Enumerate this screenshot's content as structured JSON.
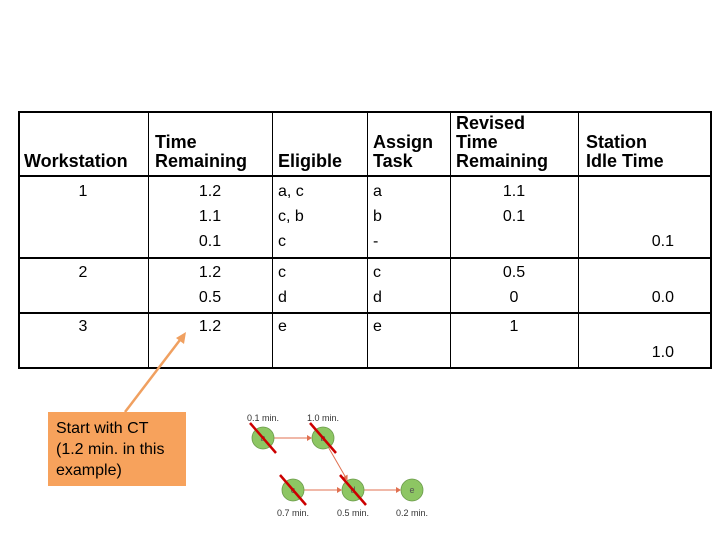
{
  "headers": {
    "workstation": "Workstation",
    "time_remaining": [
      "Time",
      "Remaining"
    ],
    "eligible": "Eligible",
    "assign_task": [
      "Assign",
      "Task"
    ],
    "revised": [
      "Revised",
      "Time",
      "Remaining"
    ],
    "idle": [
      "Station",
      "Idle Time"
    ]
  },
  "rows": [
    {
      "ws": "1",
      "lines": [
        [
          "1.2",
          "a, c",
          "a",
          "1.1"
        ],
        [
          "1.1",
          "c, b",
          "b",
          "0.1"
        ],
        [
          "0.1",
          "c",
          "-",
          ""
        ]
      ],
      "idle": "0.1"
    },
    {
      "ws": "2",
      "lines": [
        [
          "1.2",
          "c",
          "c",
          "0.5"
        ],
        [
          "0.5",
          "d",
          "d",
          "0"
        ]
      ],
      "idle": "0.0"
    },
    {
      "ws": "3",
      "lines": [
        [
          "1.2",
          "e",
          "e",
          "1"
        ]
      ],
      "idle": "1.0"
    }
  ],
  "note": "Start with CT (1.2 min. in this example)",
  "colors": {
    "note_bg": "#f7a25c",
    "arrow": "#f0a060",
    "node": "#8dc663",
    "cross": "#cc0000",
    "edge": "#e07050"
  },
  "network": {
    "nodes": [
      {
        "id": "a",
        "time": "0.1 min."
      },
      {
        "id": "b",
        "time": "1.0 min."
      },
      {
        "id": "c",
        "time": "0.7 min."
      },
      {
        "id": "d",
        "time": "0.5 min."
      },
      {
        "id": "e",
        "time": "0.2 min."
      }
    ],
    "edges": [
      [
        "a",
        "b"
      ],
      [
        "b",
        "d"
      ],
      [
        "c",
        "d"
      ],
      [
        "d",
        "e"
      ]
    ],
    "crossed_out": [
      "a",
      "b",
      "c",
      "d"
    ]
  }
}
